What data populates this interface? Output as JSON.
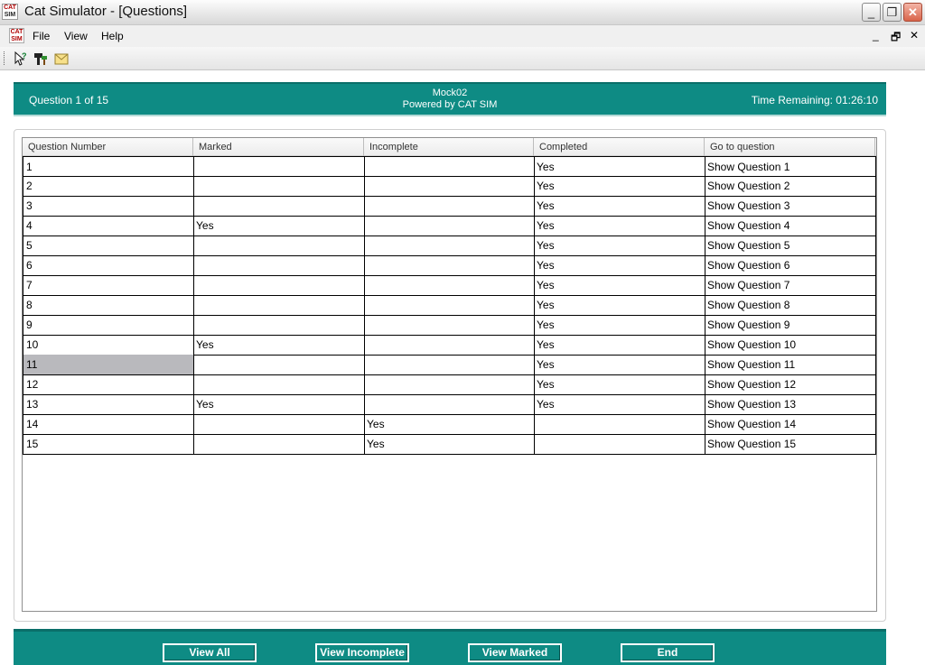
{
  "window": {
    "title": "Cat Simulator - [Questions]",
    "logo_line1": "CAT",
    "logo_line2": "SIM",
    "minimize_glyph": "_",
    "restore_glyph": "❐",
    "close_glyph": "✕"
  },
  "menu": {
    "items": [
      "File",
      "View",
      "Help"
    ],
    "mdi_minimize": "_",
    "mdi_restore": "🗗",
    "mdi_close": "✕"
  },
  "toolbar": {
    "buttons": [
      {
        "icon": "help-pointer-icon"
      },
      {
        "icon": "tools-icon"
      },
      {
        "icon": "mail-icon"
      }
    ]
  },
  "header": {
    "question_progress": "Question 1 of 15",
    "exam_name": "Mock02",
    "powered_by": "Powered by CAT SIM",
    "time_remaining": "Time Remaining: 01:26:10"
  },
  "grid": {
    "columns": [
      "Question Number",
      "Marked",
      "Incomplete",
      "Completed",
      "Go to question"
    ],
    "rows": [
      [
        "1",
        "",
        "",
        "Yes",
        "Show Question 1"
      ],
      [
        "2",
        "",
        "",
        "Yes",
        "Show Question 2"
      ],
      [
        "3",
        "",
        "",
        "Yes",
        "Show Question 3"
      ],
      [
        "4",
        "Yes",
        "",
        "Yes",
        "Show Question 4"
      ],
      [
        "5",
        "",
        "",
        "Yes",
        "Show Question 5"
      ],
      [
        "6",
        "",
        "",
        "Yes",
        "Show Question 6"
      ],
      [
        "7",
        "",
        "",
        "Yes",
        "Show Question 7"
      ],
      [
        "8",
        "",
        "",
        "Yes",
        "Show Question 8"
      ],
      [
        "9",
        "",
        "",
        "Yes",
        "Show Question 9"
      ],
      [
        "10",
        "Yes",
        "",
        "Yes",
        "Show Question 10"
      ],
      [
        "11",
        "",
        "",
        "Yes",
        "Show Question 11"
      ],
      [
        "12",
        "",
        "",
        "Yes",
        "Show Question 12"
      ],
      [
        "13",
        "Yes",
        "",
        "Yes",
        "Show Question 13"
      ],
      [
        "14",
        "",
        "Yes",
        "",
        "Show Question 14"
      ],
      [
        "15",
        "",
        "Yes",
        "",
        "Show Question 15"
      ]
    ],
    "selected_row": "11"
  },
  "footer": {
    "buttons": [
      "View All",
      "View Incomplete",
      "View Marked",
      "End"
    ]
  },
  "colors": {
    "accent": "#0e8b84",
    "selection": "#b9b9bd"
  }
}
